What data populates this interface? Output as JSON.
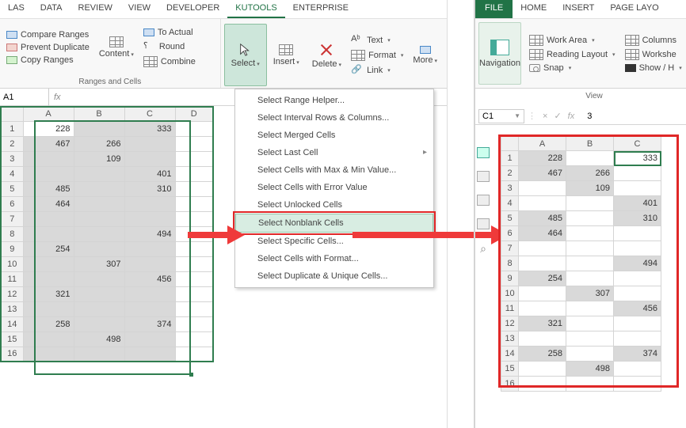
{
  "tabs_left": [
    "LAS",
    "DATA",
    "REVIEW",
    "VIEW",
    "DEVELOPER",
    "KUTOOLS",
    "ENTERPRISE"
  ],
  "active_tab_left": "KUTOOLS",
  "ribbon_left": {
    "compare": "Compare Ranges",
    "prevent": "Prevent Duplicate",
    "copy": "Copy Ranges",
    "content": "Content",
    "toactual": "To Actual",
    "round": "Round",
    "combine": "Combine",
    "group_title": "Ranges and Cells",
    "select": "Select",
    "insert": "Insert",
    "delete": "Delete",
    "text": "Text",
    "format": "Format",
    "link": "Link",
    "more": "More"
  },
  "namebox_left": "A1",
  "menu": {
    "items": [
      "Select Range Helper...",
      "Select Interval Rows & Columns...",
      "Select Merged Cells",
      "Select Last Cell",
      "Select Cells with Max & Min Value...",
      "Select Cells with Error Value",
      "Select Unlocked Cells",
      "Select Nonblank Cells",
      "Select Specific Cells...",
      "Select Cells with Format...",
      "Select Duplicate & Unique Cells..."
    ],
    "highlighted": "Select Nonblank Cells",
    "arrow_index": 3
  },
  "grid_left": {
    "cols": [
      "A",
      "B",
      "C",
      "D"
    ],
    "rows": [
      {
        "n": 1,
        "A": 228,
        "B": "",
        "C": 333
      },
      {
        "n": 2,
        "A": 467,
        "B": 266,
        "C": ""
      },
      {
        "n": 3,
        "A": "",
        "B": 109,
        "C": ""
      },
      {
        "n": 4,
        "A": "",
        "B": "",
        "C": 401
      },
      {
        "n": 5,
        "A": 485,
        "B": "",
        "C": 310
      },
      {
        "n": 6,
        "A": 464,
        "B": "",
        "C": ""
      },
      {
        "n": 7,
        "A": "",
        "B": "",
        "C": ""
      },
      {
        "n": 8,
        "A": "",
        "B": "",
        "C": 494
      },
      {
        "n": 9,
        "A": 254,
        "B": "",
        "C": ""
      },
      {
        "n": 10,
        "A": "",
        "B": 307,
        "C": ""
      },
      {
        "n": 11,
        "A": "",
        "B": "",
        "C": 456
      },
      {
        "n": 12,
        "A": 321,
        "B": "",
        "C": ""
      },
      {
        "n": 13,
        "A": "",
        "B": "",
        "C": ""
      },
      {
        "n": 14,
        "A": 258,
        "B": "",
        "C": 374
      },
      {
        "n": 15,
        "A": "",
        "B": 498,
        "C": ""
      },
      {
        "n": 16,
        "A": "",
        "B": "",
        "C": ""
      }
    ]
  },
  "tabs_right": [
    "FILE",
    "HOME",
    "INSERT",
    "PAGE LAYO"
  ],
  "ribbon_right": {
    "nav": "Navigation",
    "work": "Work Area",
    "reading": "Reading Layout",
    "snap": "Snap",
    "columns": "Columns",
    "worksheet": "Workshe",
    "showh": "Show / H",
    "group_title": "View"
  },
  "namebox_right": "C1",
  "fx_right_val": "3",
  "grid_right": {
    "cols": [
      "A",
      "B",
      "C"
    ],
    "rows": [
      {
        "n": 1,
        "A": 228,
        "B": "",
        "C": 333,
        "hl": [
          "A",
          "C"
        ],
        "c1": true
      },
      {
        "n": 2,
        "A": 467,
        "B": 266,
        "C": "",
        "hl": [
          "A",
          "B"
        ]
      },
      {
        "n": 3,
        "A": "",
        "B": 109,
        "C": "",
        "hl": [
          "B"
        ]
      },
      {
        "n": 4,
        "A": "",
        "B": "",
        "C": 401,
        "hl": [
          "C"
        ]
      },
      {
        "n": 5,
        "A": 485,
        "B": "",
        "C": 310,
        "hl": [
          "A",
          "C"
        ]
      },
      {
        "n": 6,
        "A": 464,
        "B": "",
        "C": "",
        "hl": [
          "A"
        ]
      },
      {
        "n": 7,
        "A": "",
        "B": "",
        "C": "",
        "hl": []
      },
      {
        "n": 8,
        "A": "",
        "B": "",
        "C": 494,
        "hl": [
          "C"
        ]
      },
      {
        "n": 9,
        "A": 254,
        "B": "",
        "C": "",
        "hl": [
          "A"
        ]
      },
      {
        "n": 10,
        "A": "",
        "B": 307,
        "C": "",
        "hl": [
          "B"
        ]
      },
      {
        "n": 11,
        "A": "",
        "B": "",
        "C": 456,
        "hl": [
          "C"
        ]
      },
      {
        "n": 12,
        "A": 321,
        "B": "",
        "C": "",
        "hl": [
          "A"
        ]
      },
      {
        "n": 13,
        "A": "",
        "B": "",
        "C": "",
        "hl": []
      },
      {
        "n": 14,
        "A": 258,
        "B": "",
        "C": 374,
        "hl": [
          "A",
          "C"
        ]
      },
      {
        "n": 15,
        "A": "",
        "B": 498,
        "C": "",
        "hl": [
          "B"
        ]
      },
      {
        "n": 16,
        "A": "",
        "B": "",
        "C": "",
        "hl": []
      }
    ]
  }
}
